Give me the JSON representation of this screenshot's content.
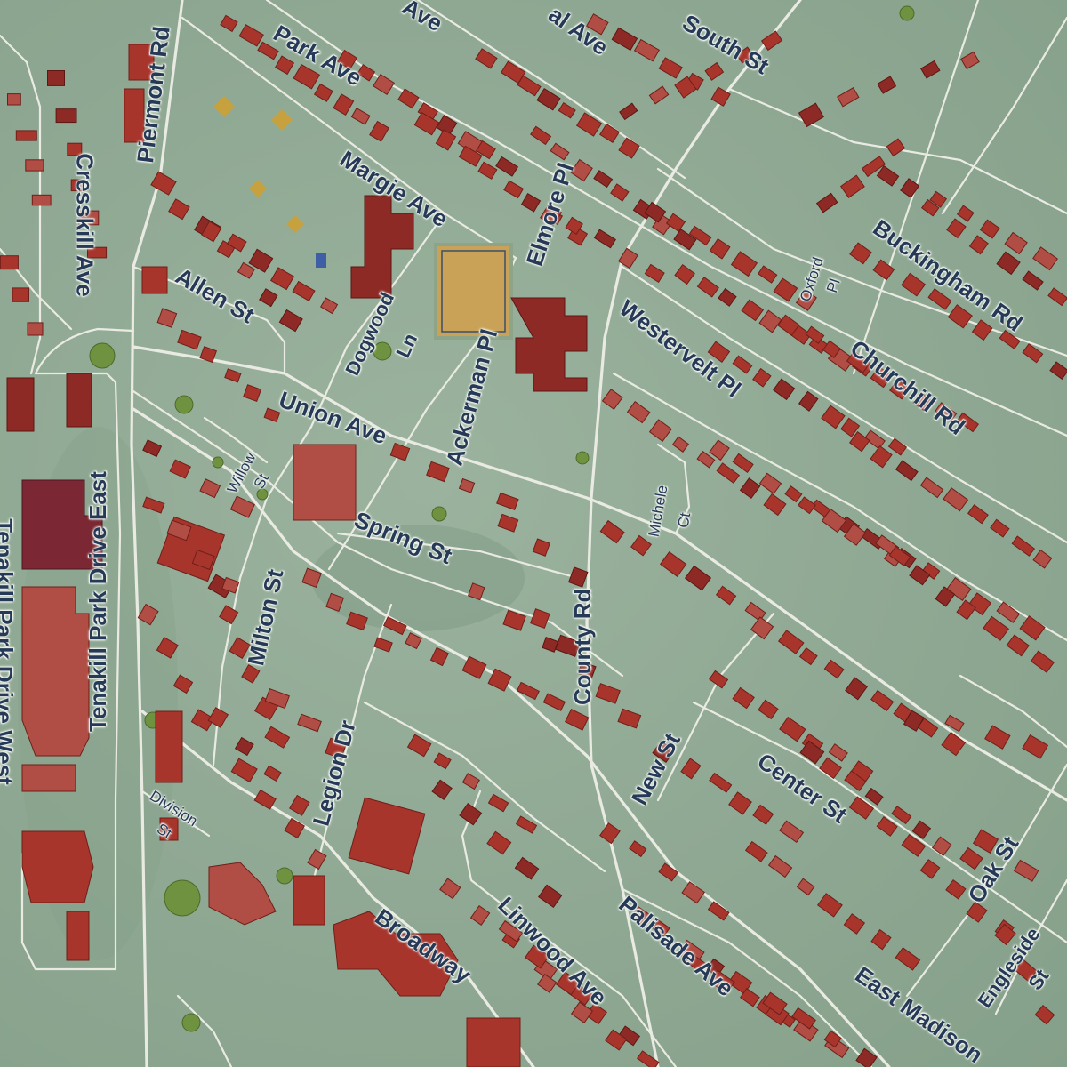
{
  "map": {
    "streets": {
      "park_ave": "Park Ave",
      "park_ave_2": "Ave",
      "central_ave": "al Ave",
      "south_st": "South St",
      "piermont_rd": "Piermont Rd",
      "cresskill_ave": "Cresskill Ave",
      "margie_ave": "Margie Ave",
      "elmore_pl": "Elmore Pl",
      "allen_st": "Allen St",
      "dogwood_ln_1": "Dogwood",
      "dogwood_ln_2": "Ln",
      "ackerman_pl": "Ackerman Pl",
      "buckingham_rd": "Buckingham Rd",
      "oxford_1": "Oxford",
      "oxford_2": "Pl",
      "westervelt_pl": "Westervelt Pl",
      "churchill_rd": "Churchill Rd",
      "union_ave": "Union Ave",
      "tenakill_east": "Tenakill Park Drive East",
      "tenakill_west": "Tenakill Park Drive West",
      "willow_1": "Willow",
      "willow_2": "St",
      "spring_st": "Spring St",
      "michele_1": "Michele",
      "michele_2": "Ct",
      "milton_st": "Milton St",
      "county_rd": "County Rd",
      "legion_dr": "Legion Dr",
      "new_st": "New St",
      "center_st": "Center St",
      "oak_st": "Oak St",
      "division_1": "Division",
      "division_2": "St",
      "broadway": "Broadway",
      "linwood_ave": "Linwood Ave",
      "palisade_ave": "Palisade Ave",
      "east_madison": "East Madison",
      "engleside_1": "Engleside",
      "engleside_2": "St"
    },
    "colors": {
      "land": "#8fa893",
      "road": "#e9ebe2",
      "building": "#a8352c",
      "label": "#263a58",
      "field": "#c9a257"
    }
  }
}
